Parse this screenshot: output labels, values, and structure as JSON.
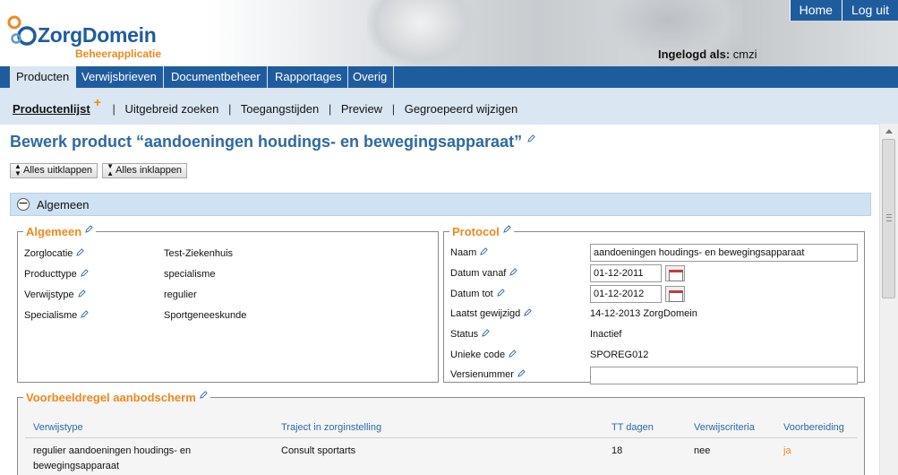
{
  "header": {
    "logo_name": "ZorgDomein",
    "logo_sub": "Beheerapplicatie",
    "top_links": [
      "Home",
      "Log uit"
    ],
    "login_label": "Ingelogd als:",
    "login_user": "cmzi"
  },
  "mainnav": {
    "tabs": [
      "Producten",
      "Verwijsbrieven",
      "Documentbeheer",
      "Rapportages",
      "Overig"
    ],
    "active": "Producten"
  },
  "subnav": {
    "items": [
      "Productenlijst",
      "Uitgebreid zoeken",
      "Toegangstijden",
      "Preview",
      "Gegroepeerd wijzigen"
    ],
    "active": "Productenlijst",
    "plus": "+",
    "separator": "|"
  },
  "page": {
    "title": "Bewerk product “aandoeningen houdings- en bewegingsapparaat”",
    "expand_all": "Alles uitklappen",
    "collapse_all": "Alles inklappen"
  },
  "section": {
    "label": "Algemeen",
    "toggle": "−"
  },
  "algemeen": {
    "legend": "Algemeen",
    "fields": [
      {
        "label": "Zorglocatie",
        "value": "Test-Ziekenhuis"
      },
      {
        "label": "Producttype",
        "value": "specialisme"
      },
      {
        "label": "Verwijstype",
        "value": "regulier"
      },
      {
        "label": "Specialisme",
        "value": "Sportgeneeskunde"
      }
    ]
  },
  "protocol": {
    "legend": "Protocol",
    "naam_label": "Naam",
    "naam_value": "aandoeningen houdings- en bewegingsapparaat",
    "datum_vanaf_label": "Datum vanaf",
    "datum_vanaf_value": "01-12-2011",
    "datum_tot_label": "Datum tot",
    "datum_tot_value": "01-12-2012",
    "laatst_label": "Laatst gewijzigd",
    "laatst_value": "14-12-2013 ZorgDomein",
    "status_label": "Status",
    "status_value": "Inactief",
    "code_label": "Unieke code",
    "code_value": "SPOREG012",
    "versie_label": "Versienummer",
    "versie_value": ""
  },
  "voorbeeld": {
    "legend": "Voorbeeldregel aanbodscherm",
    "columns": [
      "Verwijstype",
      "Traject in zorginstelling",
      "TT dagen",
      "Verwijscriteria",
      "Voorbereiding"
    ],
    "row": {
      "verwijstype_line1": "regulier aandoeningen houdings- en",
      "verwijstype_line2": "bewegingsapparaat",
      "traject": "Consult sportarts",
      "tt_dagen": "18",
      "criteria": "nee",
      "voorbereiding": "ja"
    }
  },
  "colors": {
    "brand_blue": "#1f5c9e",
    "accent_orange": "#ee8a1e",
    "light_blue": "#dae6f2"
  }
}
